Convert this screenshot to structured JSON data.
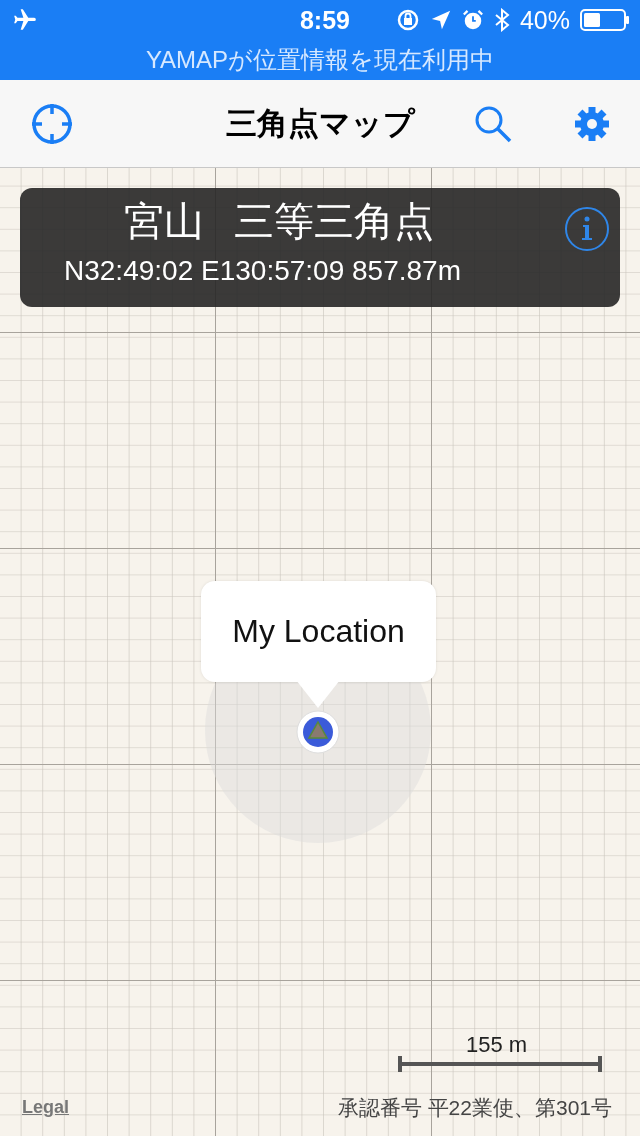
{
  "status_bar": {
    "time": "8:59",
    "battery": "40%"
  },
  "location_banner": {
    "text": "YAMAPが位置情報を現在利用中"
  },
  "nav_bar": {
    "title": "三角点マップ"
  },
  "info_card": {
    "name": "宮山",
    "grade": "三等三角点",
    "coordinates": "N32:49:02 E130:57:09 857.87m"
  },
  "callout": {
    "label": "My Location"
  },
  "scale": {
    "label": "155 m"
  },
  "footer": {
    "legal": "Legal",
    "attribution": "承認番号 平22業使、第301号"
  }
}
